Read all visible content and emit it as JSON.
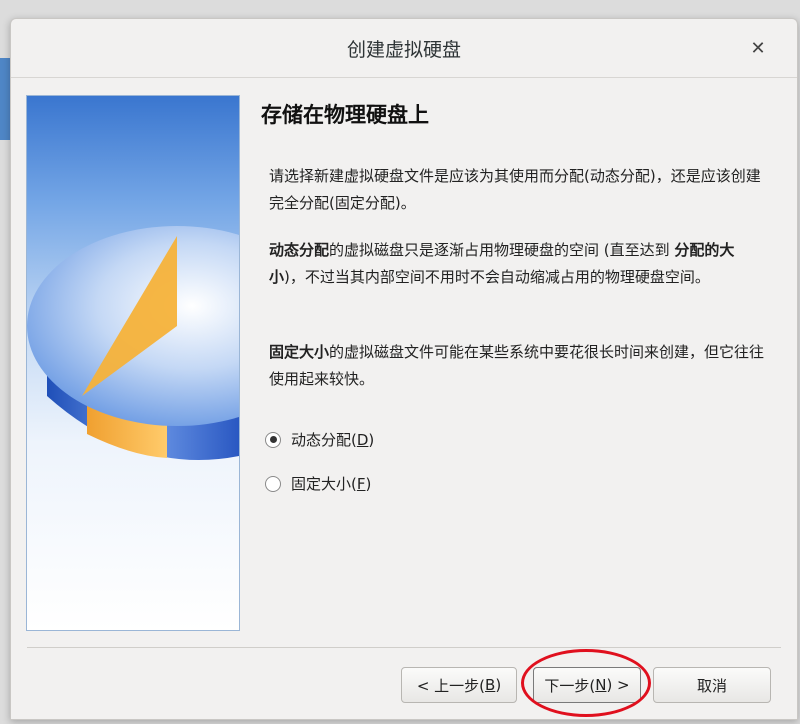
{
  "dialog": {
    "title": "创建虚拟硬盘",
    "close_icon": "close-icon"
  },
  "page": {
    "heading": "存储在物理硬盘上",
    "para1": "请选择新建虚拟硬盘文件是应该为其使用而分配(动态分配)，还是应该创建完全分配(固定分配)。",
    "para2_bold1": "动态分配",
    "para2_mid": "的虚拟磁盘只是逐渐占用物理硬盘的空间 (直至达到 ",
    "para2_bold2": "分配的大小",
    "para2_end": ")，不过当其内部空间不用时不会自动缩减占用的物理硬盘空间。",
    "para3_bold": "固定大小",
    "para3_rest": "的虚拟磁盘文件可能在某些系统中要花很长时间来创建，但它往往使用起来较快。"
  },
  "options": {
    "dynamic_label": "动态分配(",
    "dynamic_key": "D",
    "dynamic_close": ")",
    "dynamic_selected": true,
    "fixed_label": "固定大小(",
    "fixed_key": "F",
    "fixed_close": ")",
    "fixed_selected": false
  },
  "buttons": {
    "back_prefix": "< 上一步(",
    "back_key": "B",
    "back_suffix": ")",
    "next_prefix": "下一步(",
    "next_key": "N",
    "next_suffix": ") >",
    "cancel": "取消"
  },
  "colors": {
    "annotation": "#e0101e",
    "pie_orange": "#f5a623",
    "pie_blue": "#3f6fd6"
  }
}
